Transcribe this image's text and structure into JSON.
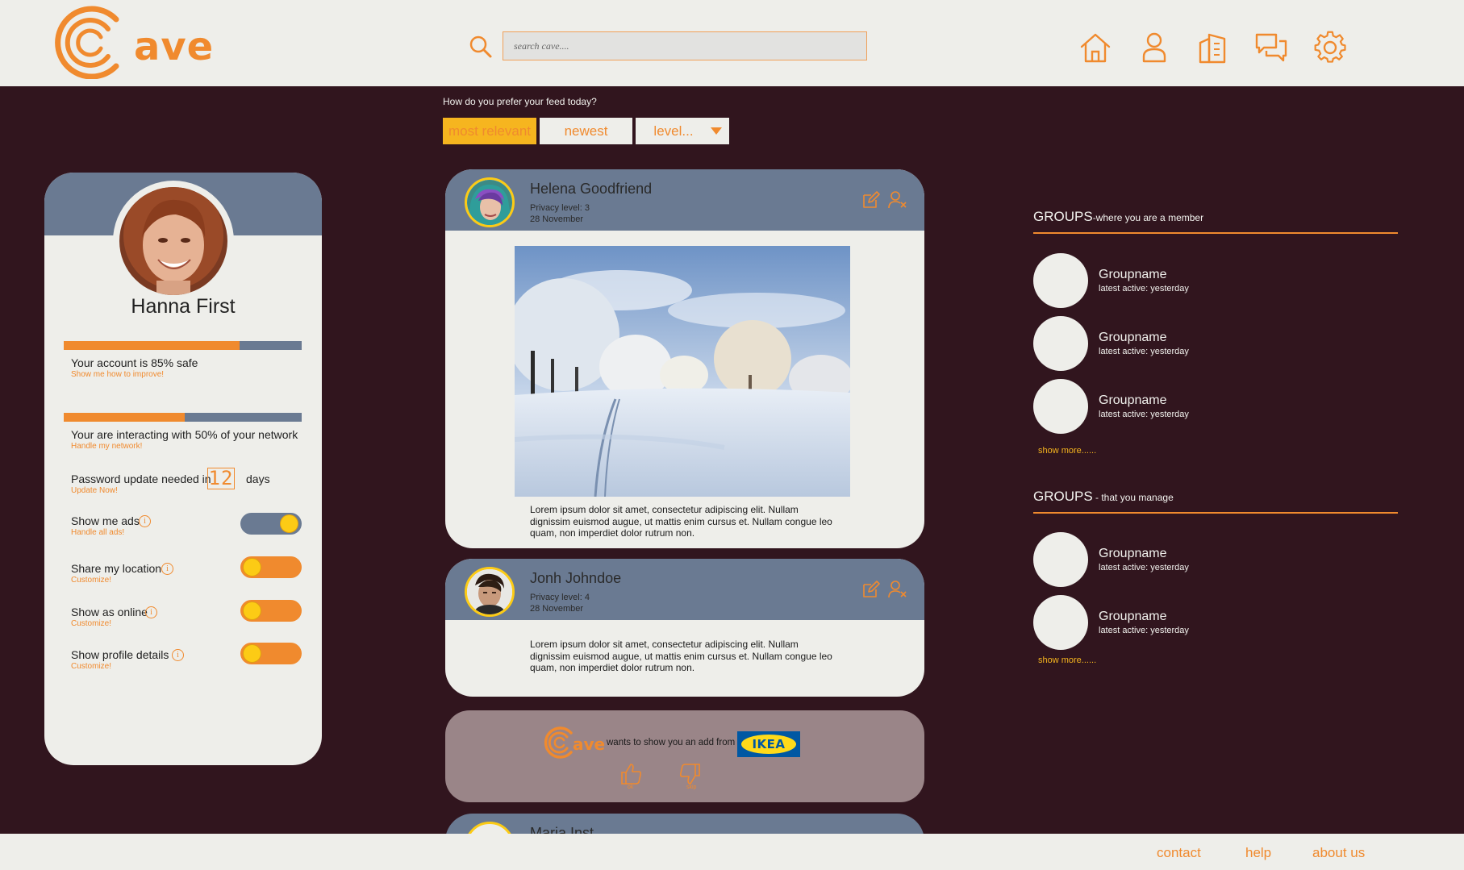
{
  "brand": {
    "name": "ave",
    "accent": "#f08a2e",
    "dark": "#31151e",
    "slate": "#6a7a92",
    "yellow": "#fccb15"
  },
  "search": {
    "placeholder": "search cave...."
  },
  "nav": {
    "icons": [
      "home-icon",
      "user-icon",
      "buildings-icon",
      "chat-icon",
      "gear-icon"
    ]
  },
  "feed": {
    "question": "How do you prefer your feed today?",
    "filters": {
      "most_relevant": "most relevant",
      "newest": "newest",
      "level": "level..."
    }
  },
  "profile": {
    "name": "Hanna First",
    "safety": {
      "text": "Your account is 85% safe",
      "link": "Show me how to improve!",
      "progress": 0.74
    },
    "network": {
      "text": "Your are interacting with 50% of your network",
      "link": "Handle my network!",
      "progress": 0.51
    },
    "password": {
      "text": "Password update needed in",
      "days_value": "12",
      "days_label": "days",
      "link": "Update Now!"
    },
    "settings": [
      {
        "label": "Show me ads",
        "link": "Handle all ads!",
        "on": true
      },
      {
        "label": "Share my location",
        "link": "Customize!",
        "on": false
      },
      {
        "label": "Show as online",
        "link": "Customize!",
        "on": false
      },
      {
        "label": "Show profile details",
        "link": "Customize!",
        "on": false
      }
    ]
  },
  "posts": [
    {
      "author": "Helena Goodfriend",
      "privacy": "Privacy level: 3",
      "date": "28 November",
      "body": "Lorem ipsum dolor sit amet, consectetur adipiscing elit. Nullam dignissim euismod augue, ut mattis enim cursus et. Nullam congue leo quam, non imperdiet dolor rutrum non."
    },
    {
      "author": "Jonh Johndoe",
      "privacy": "Privacy level: 4",
      "date": "28 November",
      "body": "Lorem ipsum dolor sit amet, consectetur adipiscing elit. Nullam dignissim euismod augue, ut mattis enim cursus et. Nullam congue leo quam, non imperdiet dolor rutrum non."
    },
    {
      "author": "Maria Inst..."
    }
  ],
  "ad": {
    "text": "wants to show you an add from",
    "brand": "IKEA",
    "ok": "ok",
    "skip": "skip"
  },
  "groups_member": {
    "title": "GROUPS",
    "subtitle": "-where you are a member",
    "items": [
      {
        "name": "Groupname",
        "active": "latest active: yesterday"
      },
      {
        "name": "Groupname",
        "active": "latest active: yesterday"
      },
      {
        "name": "Groupname",
        "active": "latest active: yesterday"
      }
    ],
    "show_more": "show more......"
  },
  "groups_manage": {
    "title": "GROUPS",
    "subtitle": " - that you manage",
    "items": [
      {
        "name": "Groupname",
        "active": "latest active: yesterday"
      },
      {
        "name": "Groupname",
        "active": "latest active: yesterday"
      }
    ],
    "show_more": "show more......"
  },
  "footer": {
    "contact": "contact",
    "help": "help",
    "about": "about us"
  }
}
